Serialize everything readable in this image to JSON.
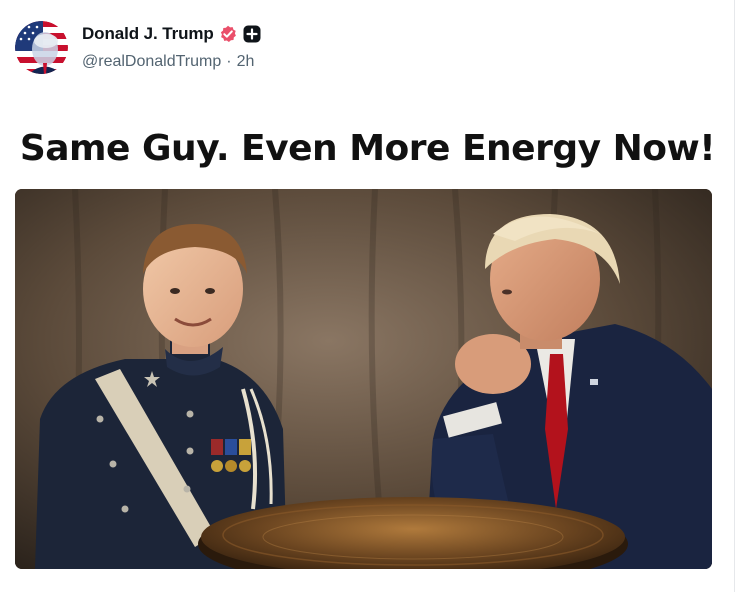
{
  "post": {
    "author": {
      "display_name": "Donald J. Trump",
      "handle": "@realDonaldTrump",
      "separator": "·",
      "time": "2h"
    },
    "headline": "Same Guy. Even More Energy Now!",
    "image": {
      "subject": "Two men seated at a round wooden table",
      "palette": {
        "backdrop": "#5b4a3a",
        "uniform": "#1c2538",
        "suit": "#1a2440",
        "tie": "#b3121c",
        "sash": "#d9cfb8",
        "table": "#6b4520"
      }
    },
    "icons": {
      "verified": "verified-badge-icon",
      "plus": "plus-badge-icon"
    },
    "colors": {
      "verified": "#ea4f6a",
      "name_text": "#0f1419",
      "meta_text": "#536471"
    }
  }
}
